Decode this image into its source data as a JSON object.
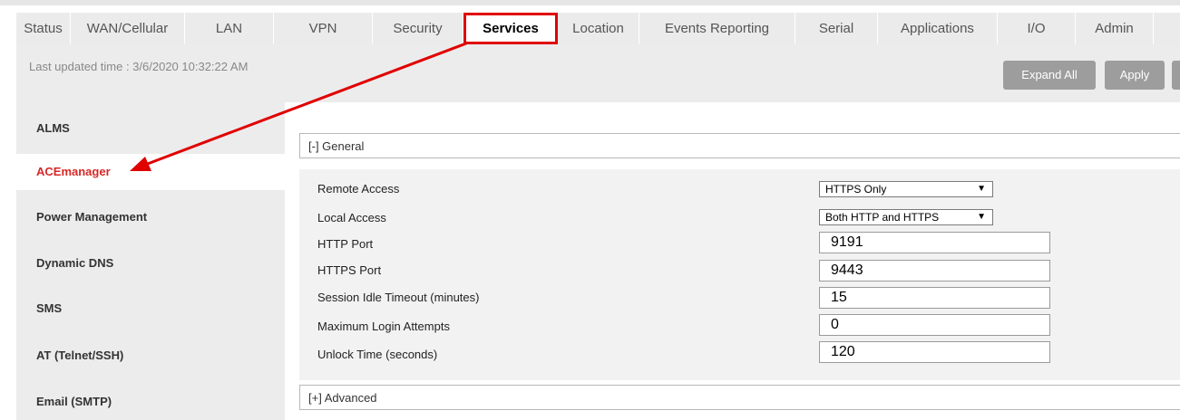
{
  "tabs": [
    {
      "label": "Status"
    },
    {
      "label": "WAN/Cellular"
    },
    {
      "label": "LAN"
    },
    {
      "label": "VPN"
    },
    {
      "label": "Security"
    },
    {
      "label": "Services",
      "active": true
    },
    {
      "label": "Location"
    },
    {
      "label": "Events Reporting"
    },
    {
      "label": "Serial"
    },
    {
      "label": "Applications"
    },
    {
      "label": "I/O"
    },
    {
      "label": "Admin"
    }
  ],
  "header": {
    "last_updated": "Last updated time : 3/6/2020 10:32:22 AM",
    "expand_all_label": "Expand All",
    "apply_label": "Apply"
  },
  "sidebar": {
    "items": [
      {
        "label": "ALMS"
      },
      {
        "label": "ACEmanager",
        "active": true
      },
      {
        "label": "Power Management"
      },
      {
        "label": "Dynamic DNS"
      },
      {
        "label": "SMS"
      },
      {
        "label": "AT (Telnet/SSH)"
      },
      {
        "label": "Email (SMTP)"
      }
    ]
  },
  "general": {
    "header": "[-] General",
    "remote_access_label": "Remote Access",
    "remote_access_value": "HTTPS Only",
    "local_access_label": "Local Access",
    "local_access_value": "Both HTTP and HTTPS",
    "http_port_label": "HTTP Port",
    "http_port_value": "9191",
    "https_port_label": "HTTPS Port",
    "https_port_value": "9443",
    "idle_timeout_label": "Session Idle Timeout (minutes)",
    "idle_timeout_value": "15",
    "max_login_label": "Maximum Login Attempts",
    "max_login_value": "0",
    "unlock_time_label": "Unlock Time (seconds)",
    "unlock_time_value": "120"
  },
  "advanced": {
    "header": "[+] Advanced"
  },
  "icons": {
    "dropdown": "caret-down-icon",
    "annotation": "red-arrow-icon"
  },
  "colors": {
    "highlight": "#e00000",
    "active_sidebar": "#d62828",
    "button": "#9d9d9d"
  }
}
